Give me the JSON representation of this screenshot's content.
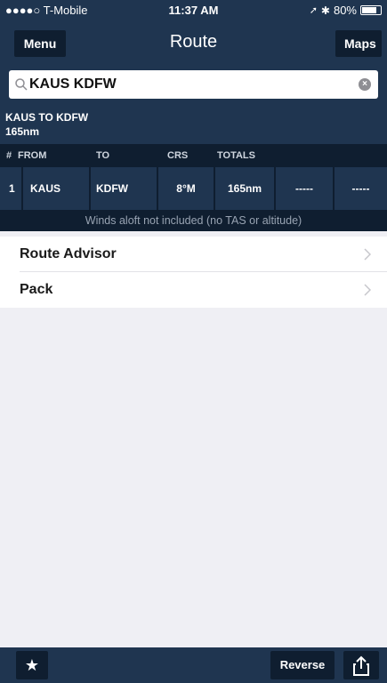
{
  "status_bar": {
    "carrier": "●●●●○ T-Mobile",
    "time": "11:37 AM",
    "battery": "80%",
    "battery_level": 0.8
  },
  "nav": {
    "title": "Route",
    "menu_label": "Menu",
    "maps_label": "Maps"
  },
  "search": {
    "value": "KAUS KDFW",
    "search_icon": "search-icon",
    "clear_icon": "clear-icon"
  },
  "route": {
    "summary_title": "KAUS TO KDFW",
    "summary_distance": "165nm"
  },
  "table": {
    "headers": [
      "#",
      "FROM",
      "TO",
      "CRS",
      "TOTALS"
    ],
    "rows": [
      {
        "num": "1",
        "from": "KAUS",
        "to": "KDFW",
        "crs": "8°M",
        "total": "165nm",
        "col5": "-----",
        "col6": "-----"
      }
    ],
    "note": "Winds aloft not included (no TAS or altitude)"
  },
  "menu": {
    "items": [
      {
        "label": "Route Advisor"
      },
      {
        "label": "Pack"
      }
    ]
  },
  "toolbar": {
    "reverse_label": "Reverse",
    "star_icon": "star-icon",
    "share_icon": "share-icon"
  },
  "colors": {
    "nav_bg": "#1f3550",
    "dark_bg": "#0f1e30",
    "page_bg": "#efeff4"
  }
}
